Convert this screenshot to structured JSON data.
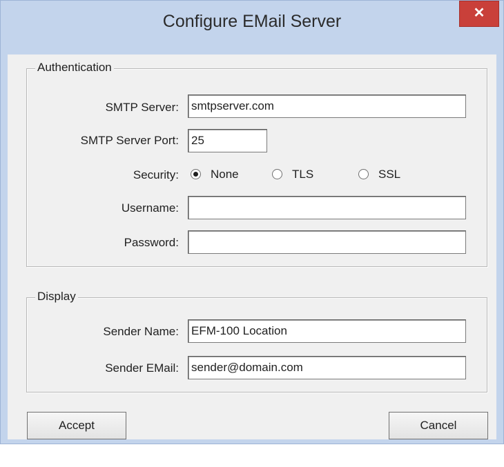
{
  "window": {
    "title": "Configure EMail Server",
    "close_glyph": "✕"
  },
  "authentication": {
    "legend": "Authentication",
    "smtp_server_label": "SMTP Server:",
    "smtp_server_value": "smtpserver.com",
    "smtp_port_label": "SMTP Server Port:",
    "smtp_port_value": "25",
    "security_label": "Security:",
    "security_options": [
      "None",
      "TLS",
      "SSL"
    ],
    "security_selected": "None",
    "username_label": "Username:",
    "username_value": "",
    "password_label": "Password:",
    "password_value": ""
  },
  "display": {
    "legend": "Display",
    "sender_name_label": "Sender Name:",
    "sender_name_value": "EFM-100 Location",
    "sender_email_label": "Sender EMail:",
    "sender_email_value": "sender@domain.com"
  },
  "buttons": {
    "accept": "Accept",
    "cancel": "Cancel"
  }
}
